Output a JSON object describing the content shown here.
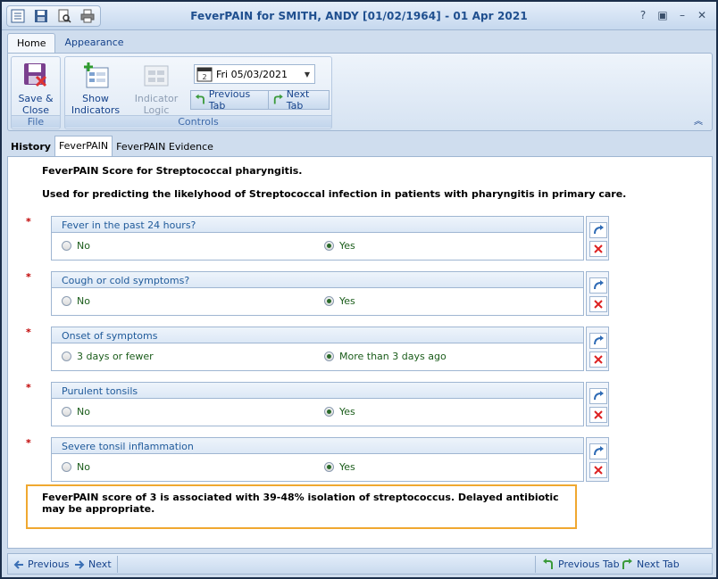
{
  "window": {
    "title": "FeverPAIN for SMITH, ANDY [01/02/1964] - 01 Apr 2021",
    "controls": [
      "?",
      "▣",
      "–",
      "✕"
    ]
  },
  "ribbon": {
    "tabs": [
      "Home",
      "Appearance"
    ],
    "file_group": {
      "label": "File",
      "save_close": "Save & Close"
    },
    "controls_group": {
      "label": "Controls",
      "show_indicators": "Show Indicators",
      "indicator_logic": "Indicator Logic",
      "date_value": "Fri 05/03/2021",
      "previous_tab": "Previous Tab",
      "next_tab": "Next Tab"
    }
  },
  "content_tabs": [
    "History",
    "FeverPAIN",
    "FeverPAIN Evidence"
  ],
  "main": {
    "heading": "FeverPAIN Score for Streptococcal pharyngitis.",
    "subheading": "Used for predicting the likelyhood of Streptococcal infection in patients with pharyngitis in primary care.",
    "required_marker": "*",
    "questions": [
      {
        "label": "Fever in the past 24 hours?",
        "options": [
          "No",
          "Yes"
        ],
        "selected": "Yes"
      },
      {
        "label": "Cough or cold symptoms?",
        "options": [
          "No",
          "Yes"
        ],
        "selected": "Yes"
      },
      {
        "label": "Onset of symptoms",
        "options": [
          "3 days or fewer",
          "More than 3 days ago"
        ],
        "selected": "More than 3 days ago"
      },
      {
        "label": "Purulent tonsils",
        "options": [
          "No",
          "Yes"
        ],
        "selected": "Yes"
      },
      {
        "label": "Severe tonsil inflammation",
        "options": [
          "No",
          "Yes"
        ],
        "selected": "Yes"
      }
    ],
    "result": "FeverPAIN score of 3 is associated with 39-48% isolation of streptococcus. Delayed antibiotic may be appropriate."
  },
  "bottom_bar": {
    "previous": "Previous",
    "next": "Next",
    "previous_tab": "Previous Tab",
    "next_tab": "Next Tab"
  },
  "colors": {
    "accent": "#15428b",
    "result_border": "#f0a830",
    "required": "#c00000",
    "option_text": "#1a5c1a"
  }
}
